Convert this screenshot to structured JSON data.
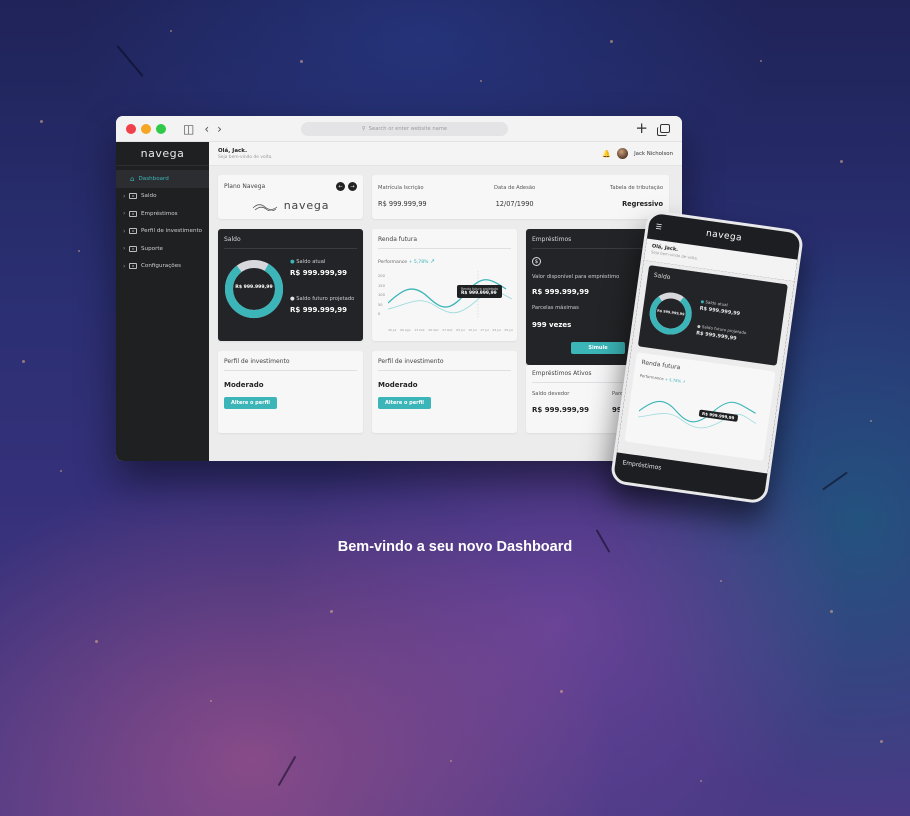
{
  "browser": {
    "address_placeholder": "Search or enter website name",
    "traffic_lights": [
      "#f0414a",
      "#f6a623",
      "#32c94b"
    ]
  },
  "app": {
    "brand": "navega",
    "greeting": {
      "title": "Olá, Jack.",
      "subtitle": "Seja bem-vindo de volta."
    },
    "user_name": "Jack Nicholson",
    "accent": "#3bb5b8",
    "nav": [
      {
        "label": "Dashboard",
        "active": true
      },
      {
        "label": "Saldo"
      },
      {
        "label": "Empréstimos"
      },
      {
        "label": "Perfil de investimento"
      },
      {
        "label": "Suporte"
      },
      {
        "label": "Configurações"
      }
    ],
    "plano": {
      "title": "Plano Navega",
      "logo_text": "navega"
    },
    "info": {
      "matricula_label": "Matrícula Iscrição",
      "matricula_value": "R$ 999.999,99",
      "adesao_label": "Data de Adesão",
      "adesao_value": "12/07/1990",
      "tabela_label": "Tabela de tributação",
      "tabela_value": "Regressivo"
    },
    "saldo": {
      "title": "Saldo",
      "center_value": "R$ 999.999,99",
      "atual_label": "Saldo atual",
      "atual_value": "R$ 999.999,99",
      "futuro_label": "Saldo futuro projetado",
      "futuro_value": "R$ 999.999,99"
    },
    "renda": {
      "title": "Renda futura",
      "performance_label": "Performance",
      "performance_value": "+ 5,78%",
      "tooltip_label": "Renda futura projetada",
      "tooltip_value": "R$ 999.999,99",
      "y_ticks": [
        "200",
        "150",
        "100",
        "50",
        "0"
      ],
      "x_ticks": [
        "30 Jul",
        "06 Ago",
        "13 Out",
        "20 Out",
        "27 Out",
        "03 Jul",
        "10 Jul",
        "17 Jul",
        "24 Jul",
        "05 Jul"
      ]
    },
    "emprestimos": {
      "title": "Empréstimos",
      "disponivel_label": "Valor disponível para empréstimo",
      "disponivel_value": "R$ 999.999,99",
      "parcelas_label": "Parcelas máximas",
      "parcelas_value": "999 vezes",
      "button": "Simule"
    },
    "perfil1": {
      "title": "Perfil de investimento",
      "value": "Moderado",
      "button": "Altere o perfil"
    },
    "perfil2": {
      "title": "Perfil de investimento",
      "value": "Moderado",
      "button": "Altere o perfil"
    },
    "ativos": {
      "title": "Empréstimos Ativos",
      "devedor_label": "Saldo devedor",
      "devedor_value": "R$ 999.999,99",
      "parcelas_label": "Parcelas",
      "parcelas_value": "999"
    }
  },
  "phone": {
    "brand": "navega",
    "greeting_title": "Olá, Jack.",
    "greeting_sub": "Seja bem-vindo de volta.",
    "saldo_title": "Saldo",
    "center_value": "R$ 999.999,99",
    "atual_label": "Saldo atual",
    "atual_value": "R$ 999.999,99",
    "futuro_label": "Saldo futuro projetado",
    "futuro_value": "R$ 999.999,99",
    "renda_title": "Renda futura",
    "performance": "Performance",
    "performance_value": "+ 5,78%",
    "tooltip_value": "R$ 999.999,99",
    "bottom_title": "Empréstimos"
  },
  "hero": {
    "title": "Bem-vindo a seu novo Dashboard"
  }
}
